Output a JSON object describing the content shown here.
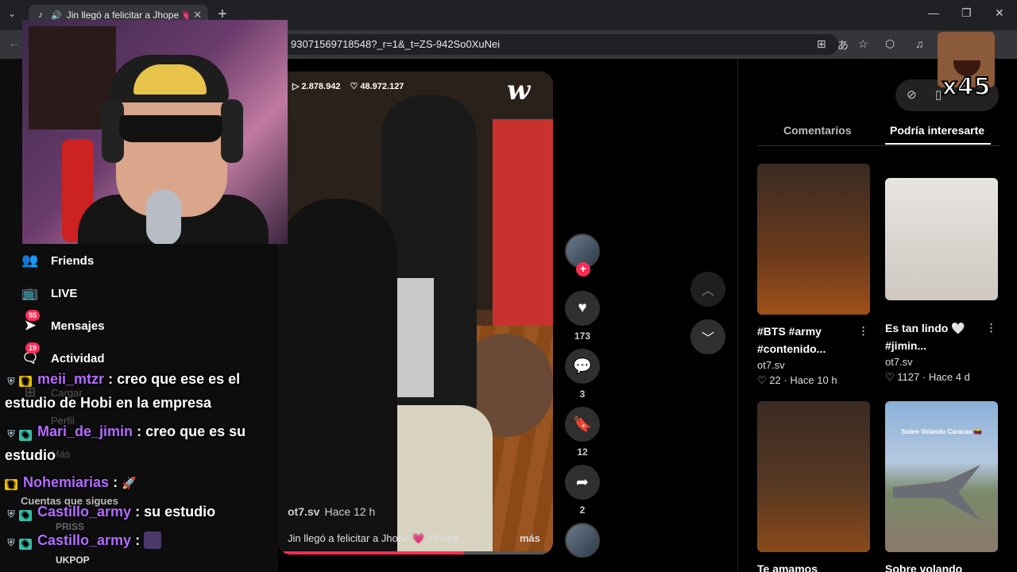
{
  "browser": {
    "tab_title": "Jin llegó a felicitar a Jhope 💗",
    "url": "93071569718548?_r=1&_t=ZS-942So0XuNei"
  },
  "sidenav": {
    "items": [
      {
        "label": "Friends"
      },
      {
        "label": "LIVE"
      },
      {
        "label": "Mensajes",
        "badge": "55"
      },
      {
        "label": "Actividad",
        "badge": "19"
      },
      {
        "label": "Cargar"
      },
      {
        "label": "Perfil"
      },
      {
        "label": "Más"
      }
    ],
    "following_header": "Cuentas que sigues",
    "following": [
      "PRISS",
      "UKPOP"
    ]
  },
  "reaction": {
    "multiplier": "x45"
  },
  "video": {
    "plays": "2.878.942",
    "likes_total": "48.972.127",
    "username": "ot7.sv",
    "time": "Hace 12 h",
    "caption": "Jin llegó a felicitar a Jhope 💗 #jhope ...",
    "more": "más",
    "progress": 0.68
  },
  "actions": {
    "likes": "173",
    "comments": "3",
    "saves": "12",
    "shares": "2"
  },
  "panel": {
    "tabs": [
      "Comentarios",
      "Podría interesarte"
    ],
    "active_tab": 1,
    "cards": [
      {
        "title": "#BTS #army\n#contenido...",
        "user": "ot7.sv",
        "likes": "22",
        "time": "Hace 10 h"
      },
      {
        "title": "Es tan lindo 🤍\n#jimin...",
        "user": "ot7.sv",
        "likes": "1127",
        "time": "Hace 4 d"
      },
      {
        "title": "Te amamos",
        "thumb_text": ""
      },
      {
        "title": "Sobre volando",
        "thumb_text": "Sobre Volando Caracas 🇻🇪"
      }
    ]
  },
  "chat": {
    "messages": [
      {
        "user": "meii_mtzr",
        "text": ": creo que ese es el estudio de Hobi en la empresa"
      },
      {
        "user": "Mari_de_jimin",
        "text": ": creo que es su estudio"
      },
      {
        "user": "Nohemiarias",
        "text": ":"
      },
      {
        "user": "Castillo_army",
        "text": ": su estudio"
      },
      {
        "user": "Castillo_army",
        "text": ":"
      }
    ]
  }
}
